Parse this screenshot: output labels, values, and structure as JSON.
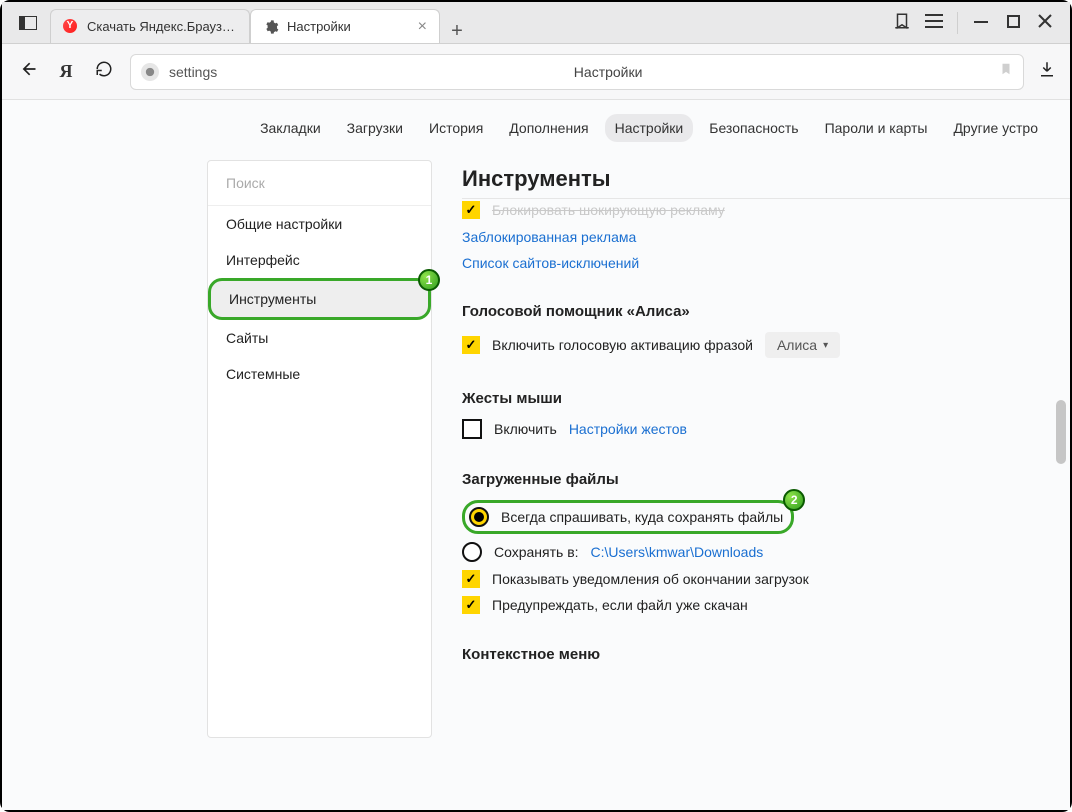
{
  "tabs": {
    "tab1_title": "Скачать Яндекс.Браузер д",
    "tab2_title": "Настройки"
  },
  "addr": {
    "url_text": "settings",
    "center_title": "Настройки"
  },
  "header_nav": {
    "bookmarks": "Закладки",
    "downloads": "Загрузки",
    "history": "История",
    "addons": "Дополнения",
    "settings": "Настройки",
    "security": "Безопасность",
    "passwords": "Пароли и карты",
    "other": "Другие устро"
  },
  "sidebar": {
    "search_placeholder": "Поиск",
    "items": {
      "general": "Общие настройки",
      "interface": "Интерфейс",
      "tools": "Инструменты",
      "sites": "Сайты",
      "system": "Системные"
    }
  },
  "page": {
    "title": "Инструменты",
    "blocked_struck": "Блокировать шокирующую рекламу",
    "link_blocked_ads": "Заблокированная реклама",
    "link_exclusions": "Список сайтов-исключений",
    "alisa_heading": "Голосовой помощник «Алиса»",
    "alisa_enable": "Включить голосовую активацию фразой",
    "alisa_select": "Алиса",
    "mouse_heading": "Жесты мыши",
    "mouse_enable": "Включить",
    "mouse_settings_link": "Настройки жестов",
    "downloads_heading": "Загруженные файлы",
    "always_ask": "Всегда спрашивать, куда сохранять файлы",
    "save_to_label": "Сохранять в:",
    "save_to_path": "C:\\Users\\kmwar\\Downloads",
    "show_notify": "Показывать уведомления об окончании загрузок",
    "warn_dup": "Предупреждать, если файл уже скачан",
    "context_menu_heading": "Контекстное меню"
  },
  "callouts": {
    "one": "1",
    "two": "2"
  }
}
